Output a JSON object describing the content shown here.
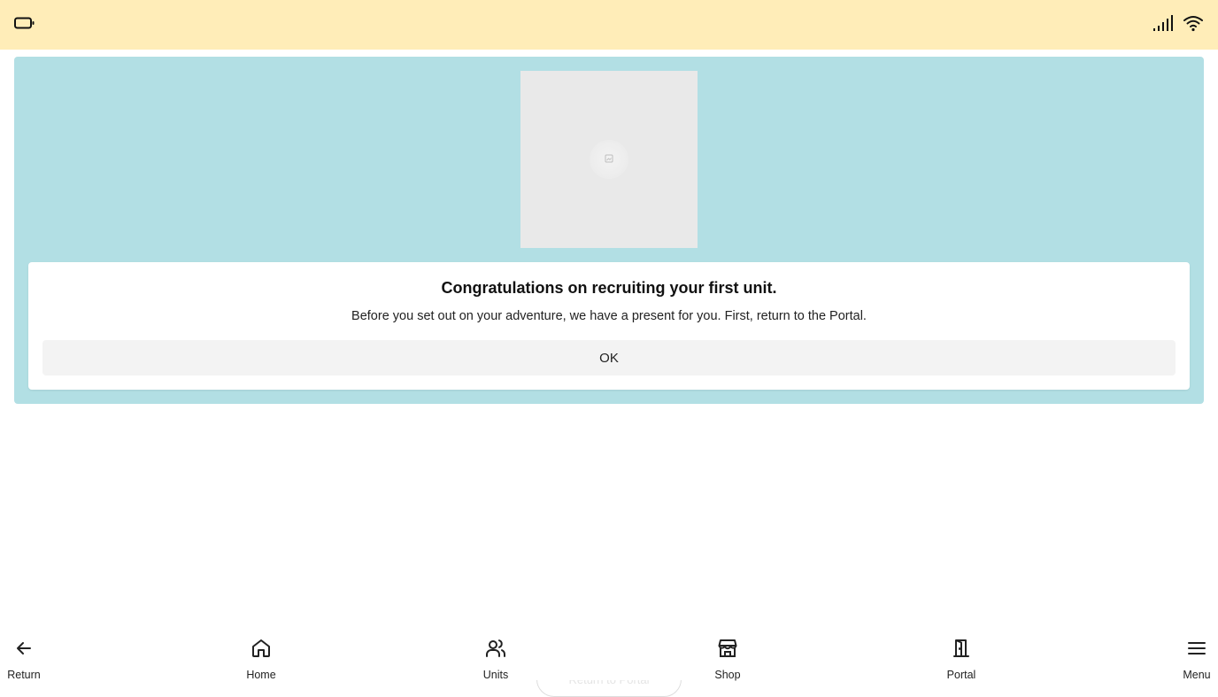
{
  "status_bar": {
    "battery_icon": "battery-icon",
    "signal_icon": "cellular-signal-icon",
    "wifi_icon": "wifi-icon",
    "background_color": "#ffedb8"
  },
  "panel": {
    "background_color": "#b2dfe4",
    "image_icon": "image-placeholder-icon"
  },
  "dialog": {
    "title": "Congratulations on recruiting your first unit.",
    "message": "Before you set out on your adventure, we have a present for you. First, return to the Portal.",
    "ok_label": "OK"
  },
  "bottom_nav": {
    "items": [
      {
        "label": "Return",
        "icon": "arrow-left-icon"
      },
      {
        "label": "Home",
        "icon": "home-icon"
      },
      {
        "label": "Units",
        "icon": "users-icon"
      },
      {
        "label": "Shop",
        "icon": "store-icon"
      },
      {
        "label": "Portal",
        "icon": "door-icon"
      },
      {
        "label": "Menu",
        "icon": "menu-icon"
      }
    ],
    "overlay_button_label": "Return to Portal"
  }
}
